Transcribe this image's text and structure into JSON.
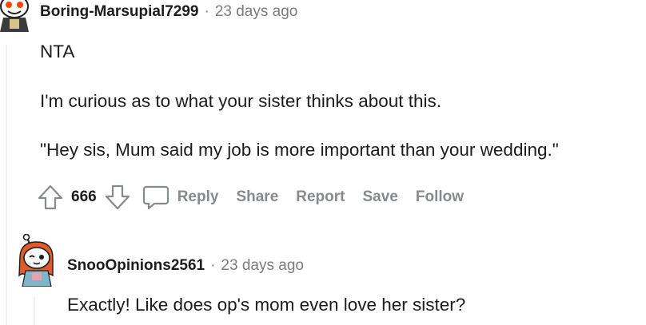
{
  "comments": [
    {
      "author": "Boring-Marsupial7299",
      "separator": "·",
      "time": "23 days ago",
      "paragraphs": [
        "NTA",
        "I'm curious as to what your sister thinks about this.",
        "\"Hey sis, Mum said my job is more important than your wedding.\""
      ],
      "score": "666",
      "actions": {
        "reply": "Reply",
        "share": "Share",
        "report": "Report",
        "save": "Save",
        "follow": "Follow"
      }
    },
    {
      "author": "SnooOpinions2561",
      "separator": "·",
      "time": "23 days ago",
      "paragraphs": [
        "Exactly! Like does op's mom even love her sister?"
      ]
    }
  ],
  "icons": {
    "upvote": "upvote-arrow-icon",
    "downvote": "downvote-arrow-icon",
    "reply": "speech-bubble-icon"
  },
  "colors": {
    "text": "#1c1c1c",
    "meta": "#7c7c7c",
    "action": "#878a8c",
    "thread_line": "#edeff1"
  }
}
